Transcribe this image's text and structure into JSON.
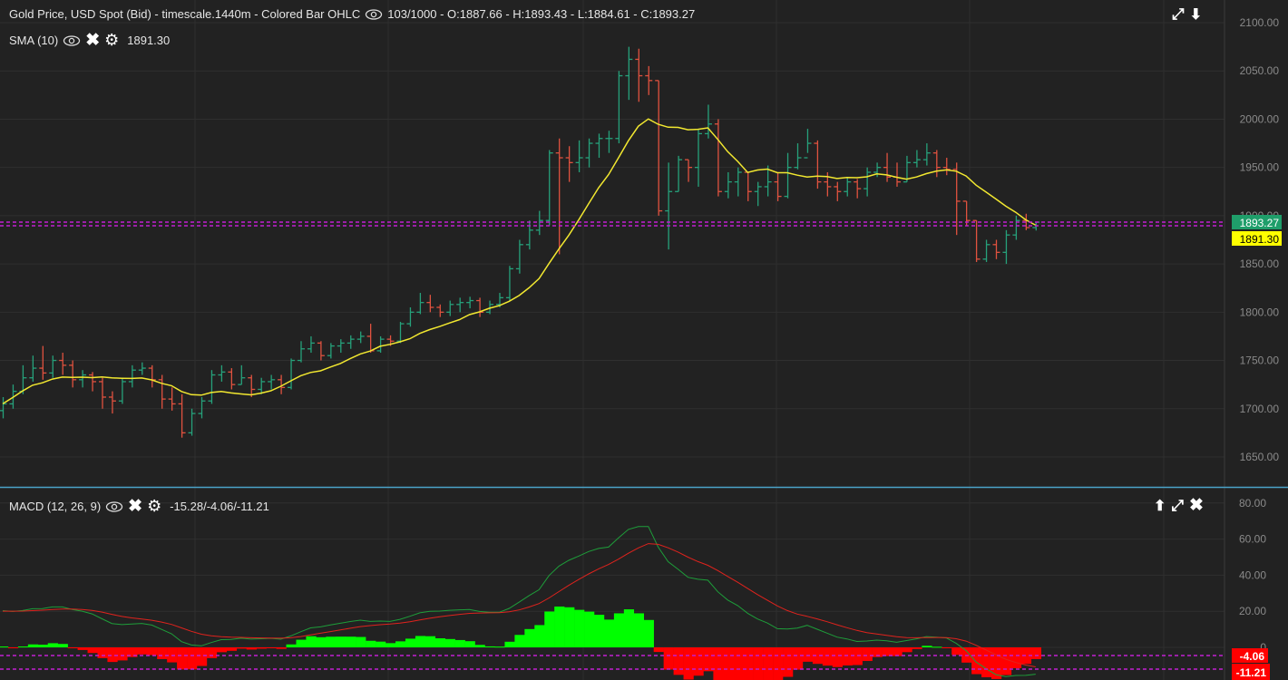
{
  "header": {
    "title": "Gold Price, USD Spot (Bid) - timescale.1440m - Colored Bar OHLC",
    "readout": "103/1000 - O:1887.66 - H:1893.43 - L:1884.61 - C:1893.27"
  },
  "sma": {
    "label": "SMA (10)",
    "value": "1891.30",
    "period": 10
  },
  "macd": {
    "label": "MACD (12, 26, 9)",
    "value": "-15.28/-4.06/-11.21",
    "fast": 12,
    "slow": 26,
    "signal": 9
  },
  "price_axis": {
    "ticks": [
      "2100.00",
      "2050.00",
      "2000.00",
      "1950.00",
      "1900.00",
      "1850.00",
      "1800.00",
      "1750.00",
      "1700.00",
      "1650.00"
    ],
    "last_price_label": "1893.27",
    "sma_label": "1891.30"
  },
  "macd_axis": {
    "ticks": [
      "80.00",
      "60.00",
      "40.00",
      "20.00",
      "0"
    ],
    "label_a": "-4.06",
    "label_b": "-11.21"
  },
  "colors": {
    "up": "#26a17b",
    "down": "#e0523f",
    "sma": "#f2e830",
    "macd": "#1e9e3a",
    "signal": "#e0231d",
    "hist_up": "#00ff00",
    "hist_down": "#ff0000",
    "guide": "#c21fd1"
  },
  "chart_data": {
    "type": "ohlc",
    "ylim": [
      1625,
      2110
    ],
    "macd_ylim": [
      -17,
      90
    ],
    "first_open": 1698,
    "close": [
      1705,
      1718,
      1732,
      1742,
      1737,
      1750,
      1745,
      1730,
      1735,
      1728,
      1712,
      1708,
      1728,
      1740,
      1742,
      1730,
      1710,
      1705,
      1675,
      1695,
      1708,
      1735,
      1738,
      1725,
      1732,
      1720,
      1728,
      1730,
      1722,
      1750,
      1762,
      1768,
      1755,
      1765,
      1768,
      1772,
      1775,
      1760,
      1772,
      1770,
      1788,
      1800,
      1810,
      1805,
      1800,
      1808,
      1810,
      1812,
      1800,
      1808,
      1815,
      1845,
      1870,
      1885,
      1895,
      1965,
      1960,
      1955,
      1960,
      1975,
      1980,
      1980,
      2045,
      2062,
      2045,
      2040,
      1905,
      1925,
      1958,
      1950,
      1985,
      1995,
      1925,
      1935,
      1945,
      1925,
      1930,
      1935,
      1920,
      1950,
      1960,
      1975,
      1935,
      1930,
      1925,
      1935,
      1928,
      1945,
      1950,
      1940,
      1935,
      1955,
      1958,
      1965,
      1950,
      1948,
      1915,
      1895,
      1855,
      1870,
      1862,
      1880,
      1895,
      1887.66,
      1893.27
    ],
    "high": [
      1712,
      1725,
      1745,
      1755,
      1765,
      1755,
      1758,
      1750,
      1740,
      1738,
      1732,
      1718,
      1732,
      1745,
      1748,
      1745,
      1735,
      1722,
      1715,
      1700,
      1712,
      1740,
      1745,
      1742,
      1745,
      1735,
      1732,
      1735,
      1735,
      1752,
      1770,
      1775,
      1770,
      1768,
      1772,
      1776,
      1780,
      1788,
      1775,
      1776,
      1790,
      1805,
      1820,
      1818,
      1808,
      1812,
      1815,
      1816,
      1815,
      1812,
      1820,
      1848,
      1875,
      1895,
      1905,
      1968,
      1980,
      1972,
      1978,
      1980,
      1985,
      1988,
      2050,
      2075,
      2073,
      2055,
      2040,
      1955,
      1962,
      1958,
      1990,
      2015,
      2000,
      1945,
      1950,
      1945,
      1935,
      1952,
      1945,
      1965,
      1975,
      1990,
      1978,
      1945,
      1935,
      1940,
      1938,
      1950,
      1955,
      1965,
      1955,
      1962,
      1968,
      1975,
      1968,
      1960,
      1955,
      1915,
      1895,
      1875,
      1875,
      1885,
      1900,
      1902,
      1893.43
    ],
    "low": [
      1690,
      1700,
      1715,
      1728,
      1730,
      1732,
      1735,
      1722,
      1722,
      1718,
      1700,
      1695,
      1705,
      1722,
      1735,
      1722,
      1700,
      1698,
      1670,
      1672,
      1690,
      1705,
      1728,
      1720,
      1725,
      1712,
      1715,
      1720,
      1715,
      1720,
      1748,
      1758,
      1750,
      1752,
      1758,
      1762,
      1768,
      1758,
      1758,
      1765,
      1768,
      1785,
      1798,
      1800,
      1795,
      1796,
      1800,
      1804,
      1795,
      1798,
      1805,
      1812,
      1840,
      1865,
      1880,
      1890,
      1860,
      1935,
      1945,
      1950,
      1960,
      1965,
      1975,
      2020,
      2018,
      2025,
      1900,
      1865,
      1925,
      1935,
      1930,
      1980,
      1920,
      1918,
      1920,
      1915,
      1910,
      1920,
      1915,
      1918,
      1948,
      1965,
      1928,
      1920,
      1915,
      1920,
      1918,
      1920,
      1940,
      1935,
      1930,
      1935,
      1950,
      1952,
      1940,
      1942,
      1880,
      1890,
      1852,
      1852,
      1855,
      1850,
      1875,
      1885,
      1884.61
    ]
  }
}
